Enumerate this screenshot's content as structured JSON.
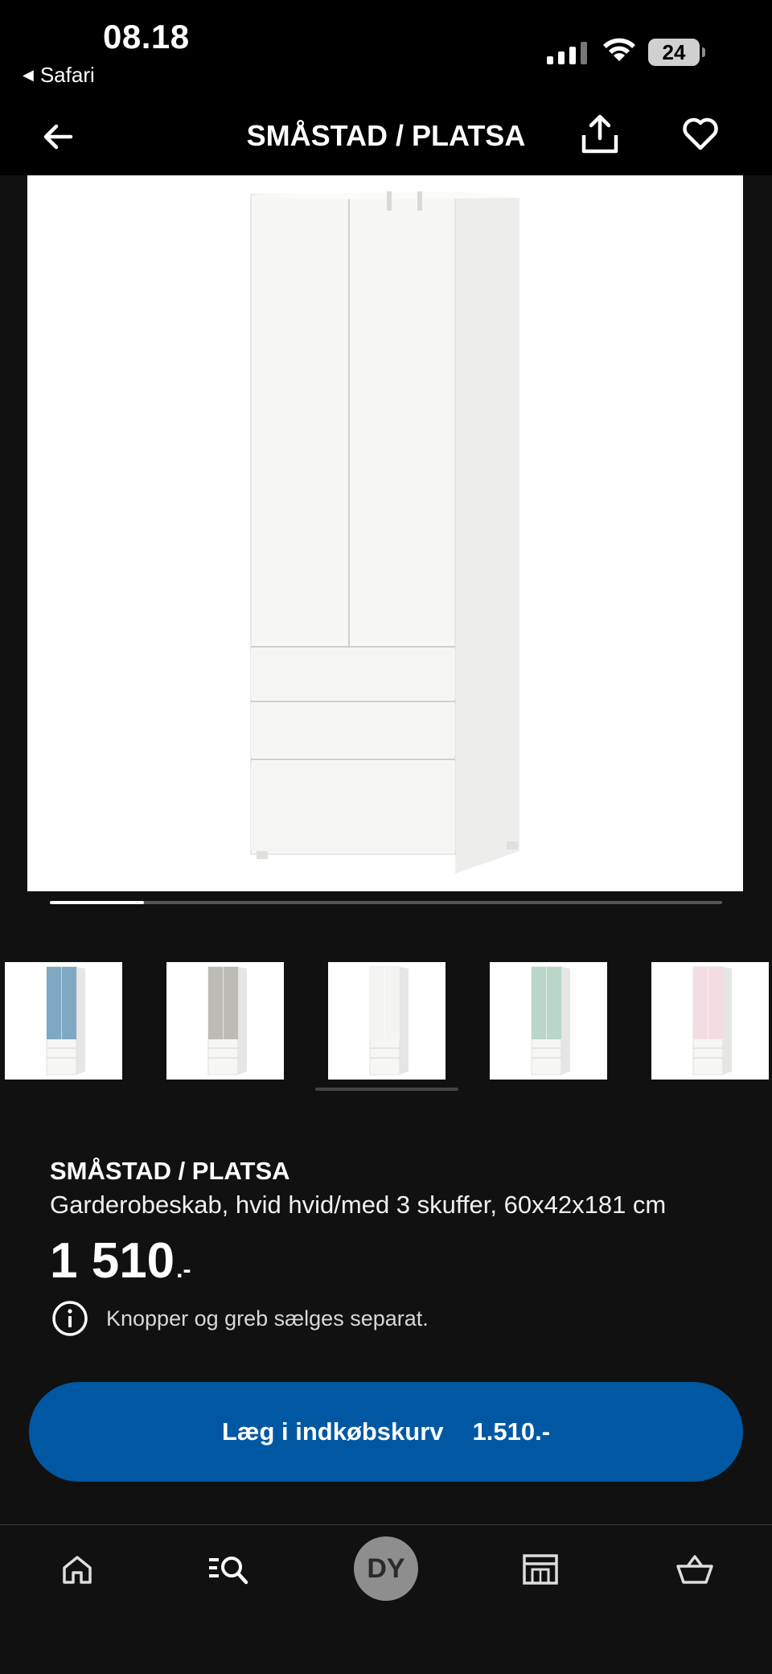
{
  "status_bar": {
    "time": "08.18",
    "back_app": "Safari",
    "battery": "24"
  },
  "header": {
    "title": "SMÅSTAD / PLATSA",
    "icons": [
      "back-arrow-icon",
      "share-icon",
      "heart-icon"
    ]
  },
  "gallery": {
    "image_progress": 0.14,
    "thumbnails": [
      {
        "label": "blue",
        "color": "#7fa8c3"
      },
      {
        "label": "grey",
        "color": "#bdbbb6"
      },
      {
        "label": "white",
        "color": "#f4f4f2"
      },
      {
        "label": "mint",
        "color": "#b9d6c8"
      },
      {
        "label": "pink",
        "color": "#f4dde2"
      }
    ]
  },
  "product": {
    "name": "SMÅSTAD / PLATSA",
    "description": "Garderobeskab, hvid hvid/med 3 skuffer, 60x42x181 cm",
    "price": "1 510",
    "price_suffix": ".-",
    "notice": "Knopper og greb sælges separat."
  },
  "cta": {
    "label": "Læg i indkøbskurv",
    "price": "1.510.-",
    "color": "#0058a3"
  },
  "bottom_nav": {
    "avatar_initials": "DY",
    "items": [
      "home-icon",
      "search-icon",
      "profile-avatar",
      "store-icon",
      "basket-icon"
    ]
  }
}
